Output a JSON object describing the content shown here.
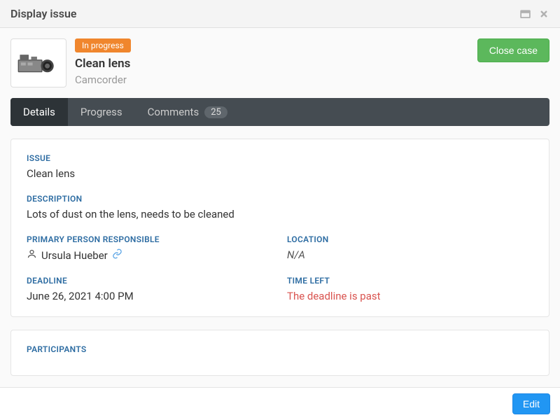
{
  "header": {
    "title": "Display issue"
  },
  "issue": {
    "status": "In progress",
    "title": "Clean lens",
    "category": "Camcorder"
  },
  "actions": {
    "close_case": "Close case",
    "edit": "Edit"
  },
  "tabs": {
    "details": "Details",
    "progress": "Progress",
    "comments": "Comments",
    "comments_count": "25"
  },
  "details": {
    "issue_label": "ISSUE",
    "issue_value": "Clean lens",
    "description_label": "DESCRIPTION",
    "description_value": "Lots of dust on the lens, needs to be cleaned",
    "primary_person_label": "PRIMARY PERSON RESPONSIBLE",
    "primary_person_value": "Ursula Hueber",
    "location_label": "LOCATION",
    "location_value": "N/A",
    "deadline_label": "DEADLINE",
    "deadline_value": "June 26, 2021 4:00 PM",
    "timeleft_label": "TIME LEFT",
    "timeleft_value": "The deadline is past"
  },
  "participants": {
    "label": "PARTICIPANTS"
  }
}
